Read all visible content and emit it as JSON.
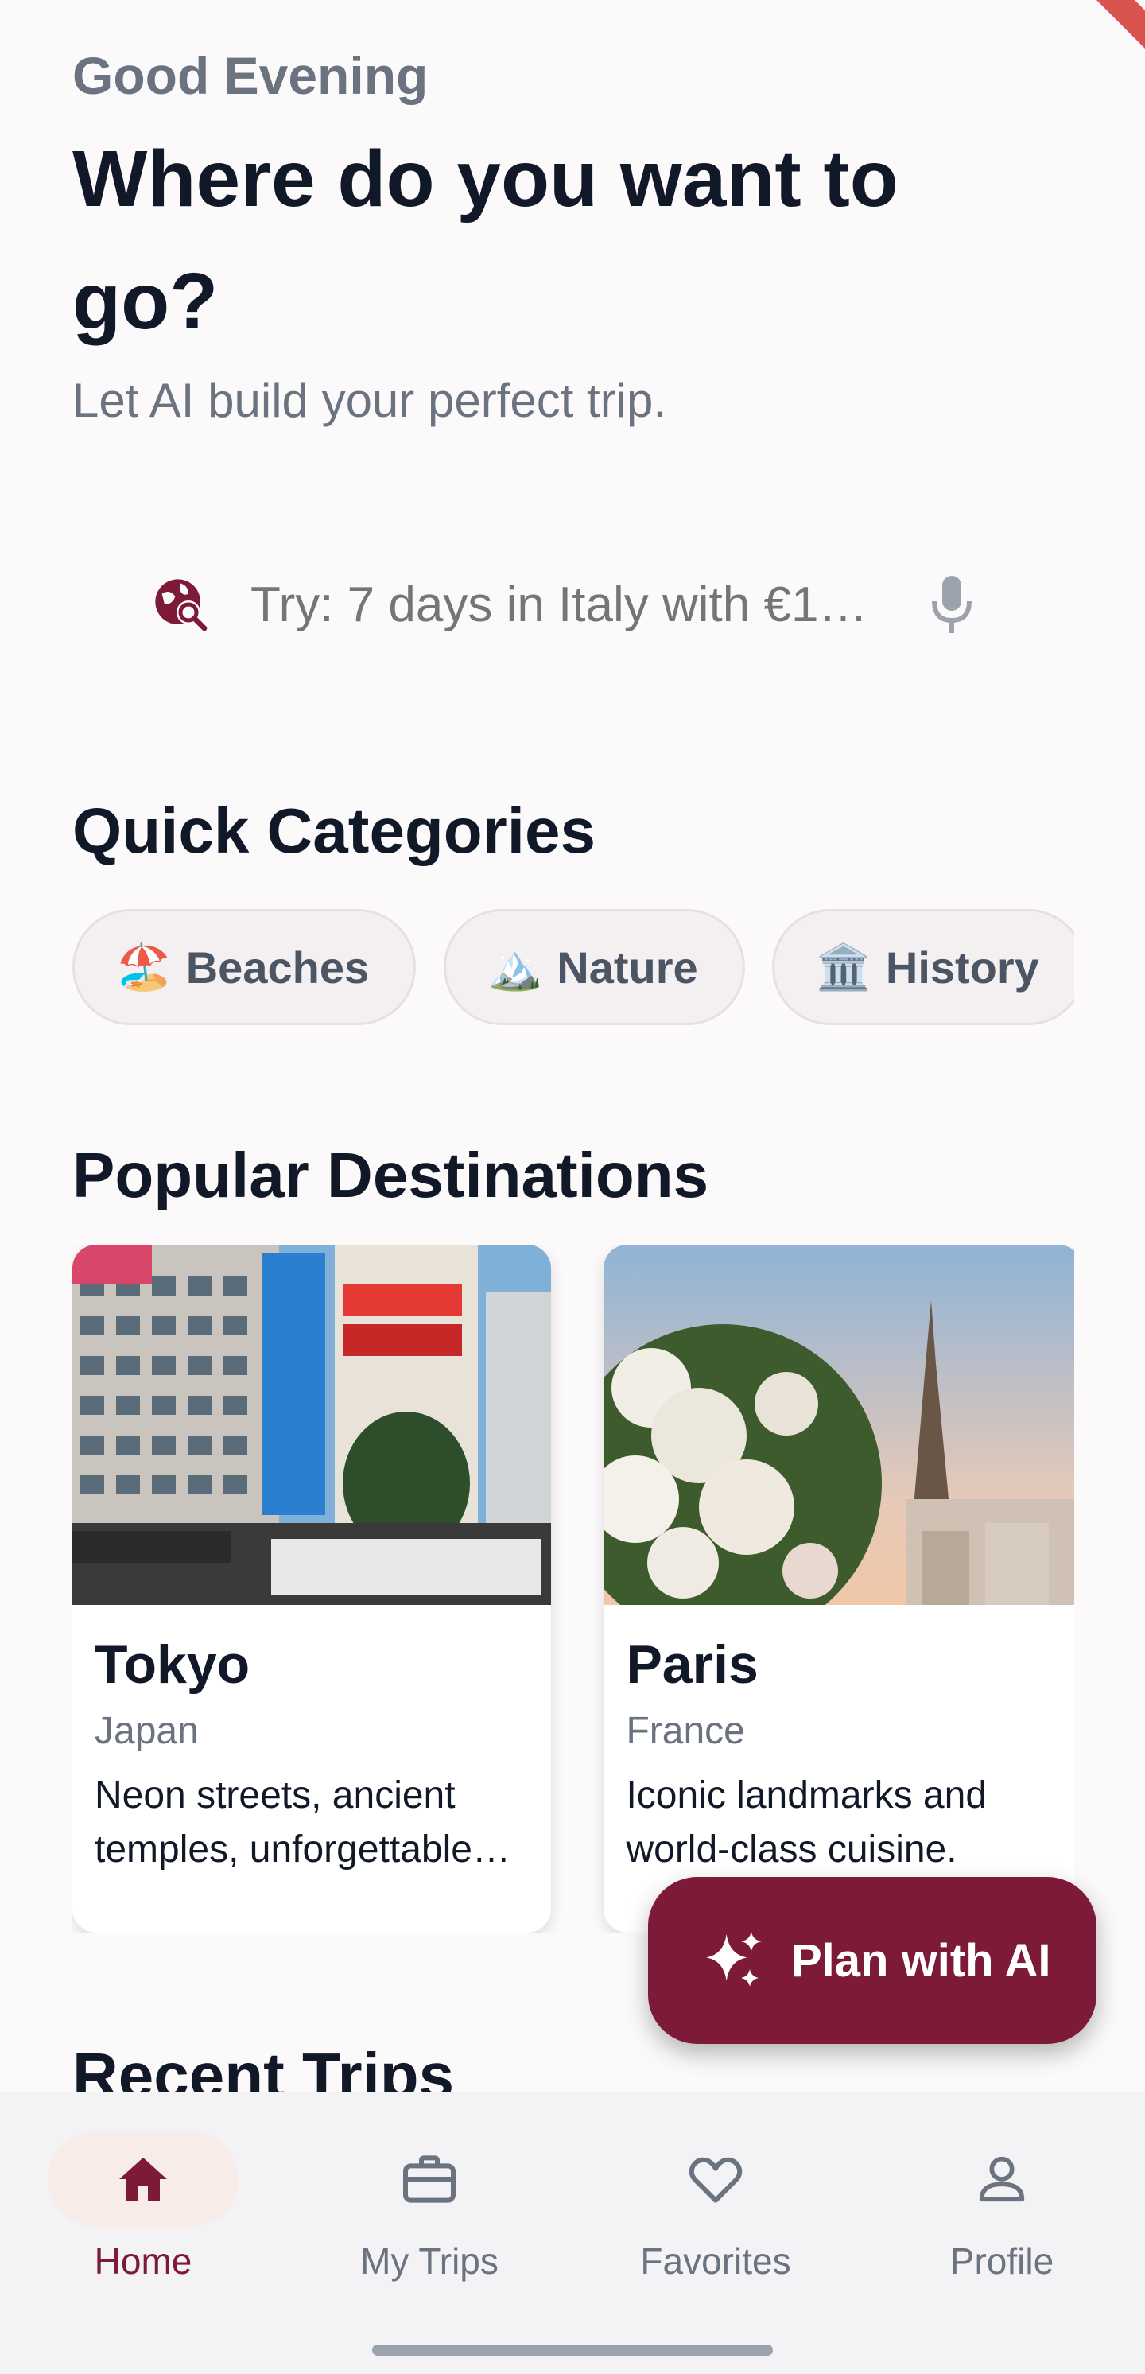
{
  "colors": {
    "accent": "#7d1a38",
    "text_primary": "#111827",
    "text_secondary": "#6b7280",
    "chip_bg": "#f4eff0",
    "nav_bg": "#f3f2f4"
  },
  "header": {
    "greeting": "Good Evening",
    "headline": "Where do you want to go?",
    "subtitle": "Let AI build your perfect trip."
  },
  "search": {
    "placeholder": "Try: 7 days in Italy with €1…",
    "left_icon": "travel-explore-icon",
    "right_icon": "mic-icon"
  },
  "quick_categories": {
    "title": "Quick Categories",
    "items": [
      {
        "emoji": "🏖️",
        "label": "Beaches"
      },
      {
        "emoji": "🏔️",
        "label": "Nature"
      },
      {
        "emoji": "🏛️",
        "label": "History"
      }
    ]
  },
  "popular_destinations": {
    "title": "Popular Destinations",
    "items": [
      {
        "city": "Tokyo",
        "country": "Japan",
        "description": "Neon streets, ancient temples, unforgettable…"
      },
      {
        "city": "Paris",
        "country": "France",
        "description": "Iconic landmarks and world-class cuisine."
      }
    ]
  },
  "recent_trips": {
    "title": "Recent Trips"
  },
  "fab": {
    "label": "Plan with AI",
    "icon": "sparkles-icon"
  },
  "bottom_nav": {
    "items": [
      {
        "label": "Home",
        "icon": "home-icon",
        "active": true
      },
      {
        "label": "My Trips",
        "icon": "briefcase-icon",
        "active": false
      },
      {
        "label": "Favorites",
        "icon": "heart-icon",
        "active": false
      },
      {
        "label": "Profile",
        "icon": "person-icon",
        "active": false
      }
    ]
  }
}
